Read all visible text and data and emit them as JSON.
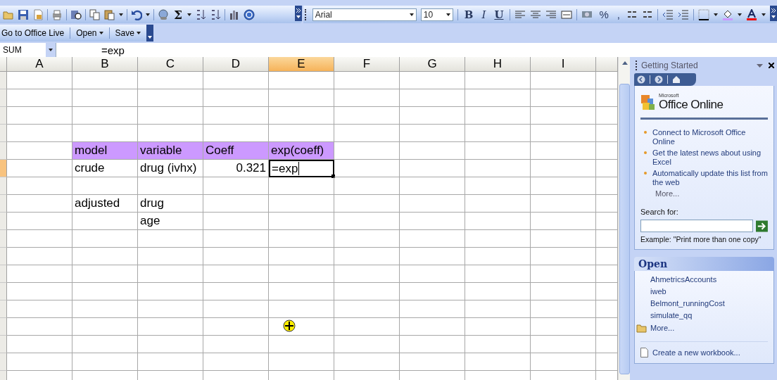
{
  "standard_toolbar": {
    "autosum": "Σ"
  },
  "formatting_toolbar": {
    "font_name": "Arial",
    "font_size": "10",
    "style_buttons": [
      "B",
      "I",
      "U"
    ],
    "number_buttons": [
      "%",
      ","
    ]
  },
  "web_toolbar": {
    "items": [
      {
        "label": "Go to Office Live",
        "kind": "button"
      },
      {
        "label": "Open",
        "kind": "menu"
      },
      {
        "label": "Save",
        "kind": "menu"
      }
    ]
  },
  "formula_bar": {
    "name_box": "SUM",
    "formula": "=exp"
  },
  "sheet": {
    "columns": [
      {
        "label": "A",
        "selected": false
      },
      {
        "label": "B",
        "selected": false
      },
      {
        "label": "C",
        "selected": false
      },
      {
        "label": "D",
        "selected": false
      },
      {
        "label": "E",
        "selected": true
      },
      {
        "label": "F",
        "selected": false
      },
      {
        "label": "G",
        "selected": false
      },
      {
        "label": "H",
        "selected": false
      },
      {
        "label": "I",
        "selected": false
      }
    ],
    "rows": [
      {
        "selected": false,
        "kind": "plain"
      },
      {
        "selected": false,
        "kind": "plain"
      },
      {
        "selected": false,
        "kind": "plain"
      },
      {
        "selected": false,
        "kind": "plain"
      },
      {
        "selected": false,
        "kind": "header",
        "cells": [
          null,
          {
            "text": "model",
            "kind": "text",
            "selected": false
          },
          {
            "text": "variable",
            "kind": "text",
            "selected": false
          },
          {
            "text": "Coeff",
            "kind": "text",
            "selected": false
          },
          {
            "text": "exp(coeff)",
            "kind": "text",
            "selected": false
          },
          null,
          null,
          null,
          null
        ]
      },
      {
        "selected": true,
        "kind": "plain",
        "cells": [
          null,
          {
            "text": "crude",
            "kind": "text",
            "selected": false
          },
          {
            "text": "drug (ivhx)",
            "kind": "text",
            "selected": false
          },
          {
            "text": "0.321",
            "kind": "number",
            "selected": false
          },
          {
            "text": "=exp",
            "kind": "text",
            "selected": true
          },
          null,
          null,
          null,
          null
        ]
      },
      {
        "selected": false,
        "kind": "plain"
      },
      {
        "selected": false,
        "kind": "plain",
        "cells": [
          null,
          {
            "text": "adjusted",
            "kind": "text",
            "selected": false
          },
          {
            "text": "drug",
            "kind": "text",
            "selected": false
          },
          null,
          null,
          null,
          null,
          null,
          null
        ]
      },
      {
        "selected": false,
        "kind": "plain",
        "cells": [
          null,
          null,
          {
            "text": "age",
            "kind": "text",
            "selected": false
          },
          null,
          null,
          null,
          null,
          null,
          null
        ]
      },
      {
        "selected": false,
        "kind": "plain"
      },
      {
        "selected": false,
        "kind": "plain"
      },
      {
        "selected": false,
        "kind": "plain"
      },
      {
        "selected": false,
        "kind": "plain"
      },
      {
        "selected": false,
        "kind": "plain"
      },
      {
        "selected": false,
        "kind": "plain"
      },
      {
        "selected": false,
        "kind": "plain"
      },
      {
        "selected": false,
        "kind": "plain"
      },
      {
        "selected": false,
        "kind": "plain"
      }
    ]
  },
  "task_pane": {
    "title": "Getting Started",
    "logo": {
      "brand": "Microsoft",
      "product": "Office Online"
    },
    "links": [
      "Connect to Microsoft Office Online",
      "Get the latest news about using Excel",
      "Automatically update this list from the web"
    ],
    "more_link": "More...",
    "search_label": "Search for:",
    "example": "Example:  \"Print more than one copy\"",
    "open_section": {
      "title": "Open",
      "files": [
        "AhmetricsAccounts",
        "iweb",
        "Belmont_runningCost",
        "simulate_qq"
      ],
      "more": "More..."
    },
    "create_link": "Create a new workbook..."
  }
}
